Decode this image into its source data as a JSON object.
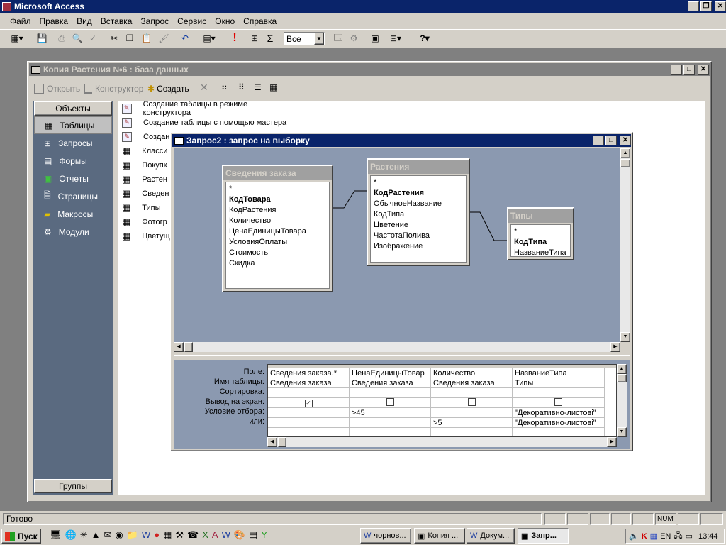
{
  "app": {
    "title": "Microsoft Access"
  },
  "menu": [
    "Файл",
    "Правка",
    "Вид",
    "Вставка",
    "Запрос",
    "Сервис",
    "Окно",
    "Справка"
  ],
  "toolbar": {
    "top_values_select": "Все"
  },
  "db_window": {
    "title": "Копия Растения №6 : база данных",
    "actions": {
      "open": "Открыть",
      "design": "Конструктор",
      "create": "Создать"
    },
    "objects_header": "Объекты",
    "groups_label": "Группы",
    "objects": [
      "Таблицы",
      "Запросы",
      "Формы",
      "Отчеты",
      "Страницы",
      "Макросы",
      "Модули"
    ],
    "list": [
      "Создание таблицы в режиме конструктора",
      "Создание таблицы с помощью мастера",
      "Создан",
      "Класси",
      "Покупк",
      "Растен",
      "Сведен",
      "Типы",
      "Фотогр",
      "Цветущ"
    ]
  },
  "query_window": {
    "title": "Запрос2 : запрос на выборку",
    "tables": [
      {
        "name": "Сведения заказа",
        "fields": [
          "*",
          "КодТовара",
          "КодРастения",
          "Количество",
          "ЦенаЕдиницыТовара",
          "УсловияОплаты",
          "Стоимость",
          "Скидка"
        ]
      },
      {
        "name": "Растения",
        "fields": [
          "*",
          "КодРастения",
          "ОбычноеНазвание",
          "КодТипа",
          "Цветение",
          "ЧастотаПолива",
          "Изображение"
        ]
      },
      {
        "name": "Типы",
        "fields": [
          "*",
          "КодТипа",
          "НазваниеТипа"
        ]
      }
    ],
    "grid": {
      "row_labels": [
        "Поле:",
        "Имя таблицы:",
        "Сортировка:",
        "Вывод на экран:",
        "Условие отбора:",
        "или:"
      ],
      "columns": [
        {
          "field": "Сведения заказа.*",
          "table": "Сведения заказа",
          "sort": "",
          "show": true,
          "criteria": "",
          "or": ""
        },
        {
          "field": "ЦенаЕдиницыТовар",
          "table": "Сведения заказа",
          "sort": "",
          "show": false,
          "criteria": ">45",
          "or": ""
        },
        {
          "field": "Количество",
          "table": "Сведения заказа",
          "sort": "",
          "show": false,
          "criteria": "",
          "or": ">5"
        },
        {
          "field": "НазваниеТипа",
          "table": "Типы",
          "sort": "",
          "show": false,
          "criteria": "\"Декоративно-листові\"",
          "or": "\"Декоративно-листові\""
        }
      ]
    }
  },
  "status": {
    "text": "Готово",
    "num": "NUM"
  },
  "taskbar": {
    "start": "Пуск",
    "tasks": [
      "чорнов...",
      "Копия ...",
      "Докум...",
      "Запр..."
    ],
    "lang": "EN",
    "clock": "13:44"
  }
}
